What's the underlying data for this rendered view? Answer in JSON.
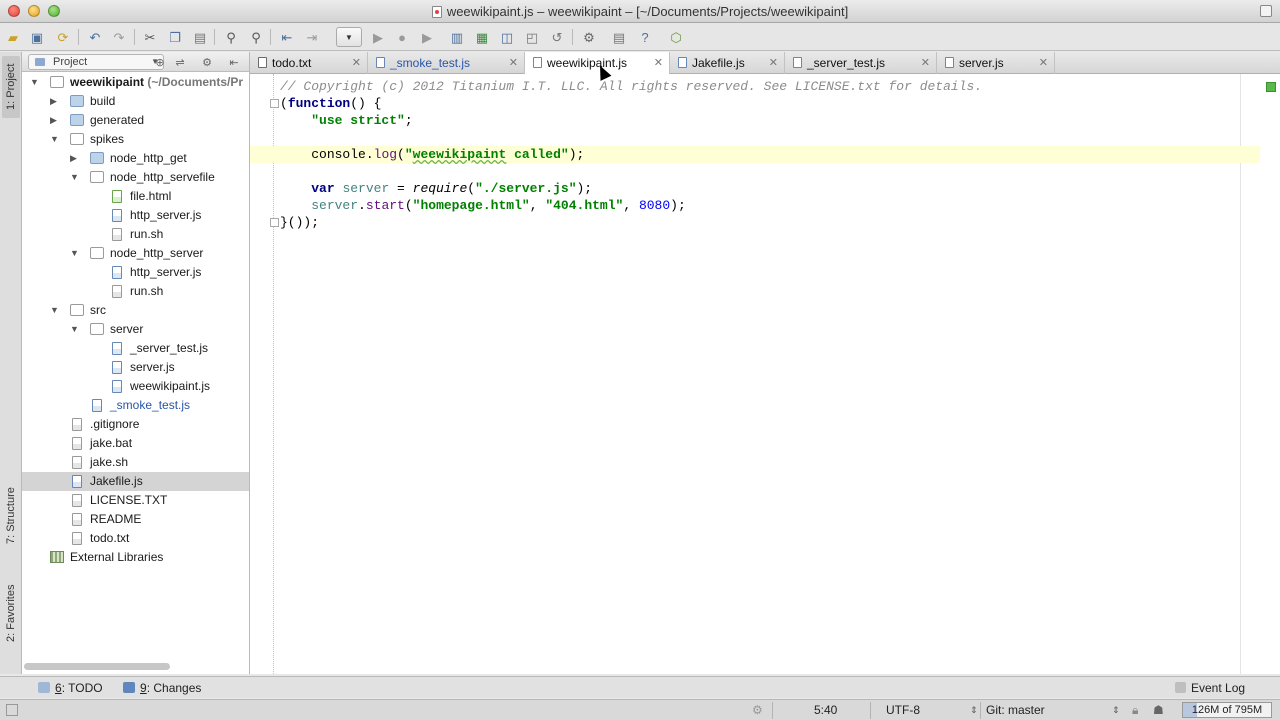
{
  "window": {
    "title": "weewikipaint.js – weewikipaint – [~/Documents/Projects/weewikipaint]"
  },
  "sidebar_tabs": {
    "project": "1: Project",
    "structure": "7: Structure",
    "favorites": "2: Favorites"
  },
  "project_panel": {
    "view_selector": "Project",
    "tree": [
      {
        "label": "weewikipaint",
        "path": "(~/Documents/Pr",
        "level": 0,
        "type": "folder-open",
        "expanded": true,
        "bold": true
      },
      {
        "label": "build",
        "level": 1,
        "type": "folder",
        "expanded": false
      },
      {
        "label": "generated",
        "level": 1,
        "type": "folder",
        "expanded": false
      },
      {
        "label": "spikes",
        "level": 1,
        "type": "folder-open",
        "expanded": true
      },
      {
        "label": "node_http_get",
        "level": 2,
        "type": "folder",
        "expanded": false
      },
      {
        "label": "node_http_servefile",
        "level": 2,
        "type": "folder-open",
        "expanded": true
      },
      {
        "label": "file.html",
        "level": 3,
        "type": "html"
      },
      {
        "label": "http_server.js",
        "level": 3,
        "type": "js"
      },
      {
        "label": "run.sh",
        "level": 3,
        "type": "sh"
      },
      {
        "label": "node_http_server",
        "level": 2,
        "type": "folder-open",
        "expanded": true
      },
      {
        "label": "http_server.js",
        "level": 3,
        "type": "js"
      },
      {
        "label": "run.sh",
        "level": 3,
        "type": "sh"
      },
      {
        "label": "src",
        "level": 1,
        "type": "folder-open",
        "expanded": true
      },
      {
        "label": "server",
        "level": 2,
        "type": "folder-open",
        "expanded": true
      },
      {
        "label": "_server_test.js",
        "level": 3,
        "type": "js"
      },
      {
        "label": "server.js",
        "level": 3,
        "type": "js"
      },
      {
        "label": "weewikipaint.js",
        "level": 3,
        "type": "js"
      },
      {
        "label": "_smoke_test.js",
        "level": 2,
        "type": "js",
        "vcs": true
      },
      {
        "label": ".gitignore",
        "level": 1,
        "type": "sh"
      },
      {
        "label": "jake.bat",
        "level": 1,
        "type": "sh"
      },
      {
        "label": "jake.sh",
        "level": 1,
        "type": "sh"
      },
      {
        "label": "Jakefile.js",
        "level": 1,
        "type": "js",
        "selected": true
      },
      {
        "label": "LICENSE.TXT",
        "level": 1,
        "type": "sh"
      },
      {
        "label": "README",
        "level": 1,
        "type": "sh"
      },
      {
        "label": "todo.txt",
        "level": 1,
        "type": "sh"
      },
      {
        "label": "External Libraries",
        "level": 0,
        "type": "libs"
      }
    ]
  },
  "tabs": [
    {
      "label": "todo.txt",
      "type": "txt",
      "active": false,
      "vcs": false
    },
    {
      "label": "_smoke_test.js",
      "type": "js",
      "active": false,
      "vcs": true
    },
    {
      "label": "weewikipaint.js",
      "type": "js",
      "active": true,
      "vcs": false
    },
    {
      "label": "Jakefile.js",
      "type": "js",
      "active": false,
      "vcs": false
    },
    {
      "label": "_server_test.js",
      "type": "js",
      "active": false,
      "vcs": false
    },
    {
      "label": "server.js",
      "type": "js",
      "active": false,
      "vcs": false
    }
  ],
  "code": {
    "copyright": "// Copyright (c) 2012 Titanium I.T. LLC. All rights reserved. See LICENSE.txt for details.",
    "kw_function": "function",
    "use_strict": "\"use strict\"",
    "console": "console",
    "log": "log",
    "called_prefix": "\"",
    "called_word": "weewikipaint",
    "called_suffix": " called\"",
    "kw_var": "var",
    "server_var": "server",
    "require_fn": "require",
    "require_arg": "\"./server.js\"",
    "server_ident": "server",
    "start_fn": "start",
    "arg1": "\"homepage.html\"",
    "arg2": "\"404.html\"",
    "arg3": "8080",
    "close": "}());"
  },
  "bottom_tools": {
    "todo_num": "6",
    "todo_label": ": TODO",
    "changes_num": "9",
    "changes_label": ": Changes",
    "event_log": "Event Log"
  },
  "status": {
    "position": "5:40",
    "encoding": "UTF-8",
    "vcs": "Git: master",
    "memory": "126M of 795M"
  },
  "colors": {
    "selection": "#d4d4d4",
    "current_line": "#ffffd6",
    "keyword": "#000080",
    "string": "#008000",
    "number": "#0000ff"
  }
}
